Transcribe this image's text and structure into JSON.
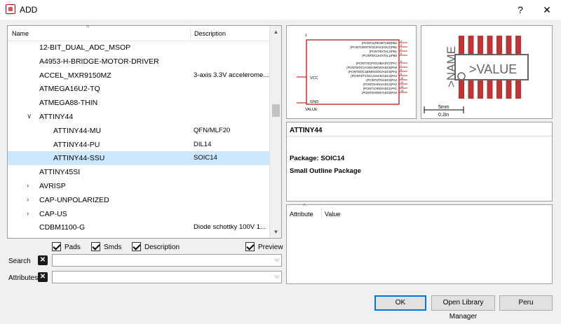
{
  "window": {
    "title": "ADD",
    "help_label": "?",
    "close_label": "✕"
  },
  "tree": {
    "columns": {
      "name": "Name",
      "description": "Description"
    },
    "rows": [
      {
        "name": "12-BIT_DUAL_ADC_MSOP",
        "description": ""
      },
      {
        "name": "A4953-H-BRIDGE-MOTOR-DRIVER",
        "description": ""
      },
      {
        "name": "ACCEL_MXR9150MZ",
        "description": "3-axis 3.3V accelerome..."
      },
      {
        "name": "ATMEGA16U2-TQ",
        "description": ""
      },
      {
        "name": "ATMEGA88-THIN",
        "description": ""
      },
      {
        "name": "ATTINY44",
        "description": "",
        "expanded": true
      },
      {
        "name": "ATTINY44-MU",
        "description": "QFN/MLF20"
      },
      {
        "name": "ATTINY44-PU",
        "description": "DIL14"
      },
      {
        "name": "ATTINY44-SSU",
        "description": "SOIC14",
        "selected": true
      },
      {
        "name": "ATTINY45SI",
        "description": ""
      },
      {
        "name": "AVRISP",
        "description": ""
      },
      {
        "name": "CAP-UNPOLARIZED",
        "description": ""
      },
      {
        "name": "CAP-US",
        "description": ""
      },
      {
        "name": "CDBM1100-G",
        "description": "Diode schottky 100V 1..."
      }
    ]
  },
  "filters": {
    "pads": {
      "label": "Pads",
      "checked": true
    },
    "smds": {
      "label": "Smds",
      "checked": true
    },
    "description": {
      "label": "Description",
      "checked": true
    },
    "preview": {
      "label": "Preview",
      "checked": true
    }
  },
  "search": {
    "label": "Search",
    "value": ""
  },
  "attributes_filter": {
    "label": "Attributes",
    "value": ""
  },
  "symbol_preview": {
    "refdes": "1",
    "pins_right": [
      "(PCINT11/RESET/dW)PB3",
      "(PCINT10/INT0/OC0A/CKOUT)PB2",
      "(PCINT9/XTAL2)PB1",
      "(PCINT8/CLKI/XTAL1)PB0",
      "(PCINT7/ICP/OC0B/ADC7)PA7",
      "(PCINT6/OC1A/SDA/MOSI/ADC6)PA6",
      "(PCINT5/OC1B/MISO/DO/ADC5)PA5",
      "(PCINT4/T1/SCL/USCK/ADC4)PA4",
      "(PCINT3/T0/ADC3)PA3",
      "(PCINT2/AIN1/ADC2)PA2",
      "(PCINT1/AIN0/ADC1)PA1",
      "(PCINT0/AREF/ADC0)PA0"
    ],
    "pin_numbers": [
      "4",
      "3",
      "2",
      "5",
      "6",
      "7",
      "8",
      "9",
      "10",
      "11",
      "12",
      "13"
    ],
    "vcc": "VCC",
    "gnd": "GND",
    "value": "VALUE"
  },
  "package_preview": {
    "name_text": ">NAME",
    "value_text": ">VALUE",
    "scale_mm": "5mm",
    "scale_in": "0.2in"
  },
  "details": {
    "device": "ATTINY44",
    "package_line": "Package: SOIC14",
    "package_desc": "Small Outline Package"
  },
  "attributes_table": {
    "columns": {
      "attribute": "Attribute",
      "value": "Value"
    }
  },
  "buttons": {
    "ok": "OK",
    "library_manager": "Open Library Manager",
    "peru": "Peru"
  },
  "colors": {
    "selection": "#cce8ff",
    "symbol_outline": "#c00000",
    "pad": "#c83232",
    "package_line": "#646464",
    "accent": "#0078d7"
  }
}
